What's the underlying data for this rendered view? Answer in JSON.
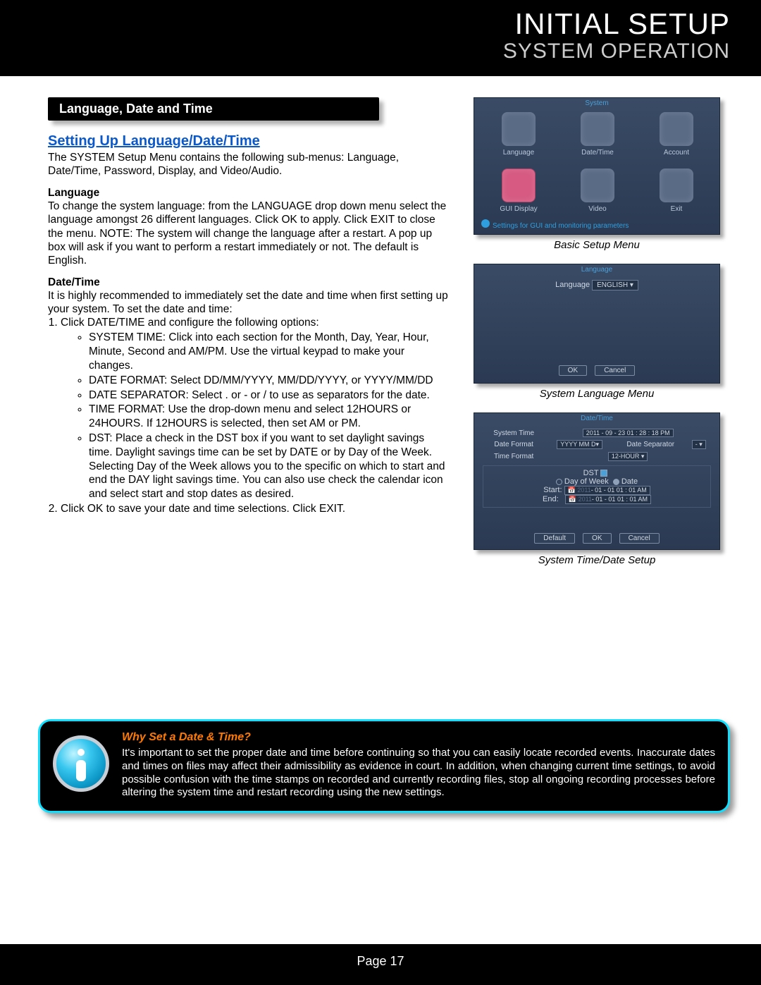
{
  "header": {
    "title1": "INITIAL SETUP",
    "title2": "SYSTEM OPERATION"
  },
  "sectionBar": "Language, Date and Time",
  "settingTitle": "Setting Up Language/Date/Time",
  "intro": "The SYSTEM Setup Menu contains the following sub-menus: Language, Date/Time, Password, Display, and Video/Audio.",
  "lang": {
    "head": "Language",
    "body": "To change the system language: from the LANGUAGE drop down menu select the language amongst 26 different languages. Click OK to apply. Click EXIT to close the menu. NOTE: The system will change the language after a restart. A pop up box will ask if you want to perform a restart immediately or not. The default is English."
  },
  "dt": {
    "head": "Date/Time",
    "lead": "It is highly recommended to immediately set the date and time when first setting up your system. To set the date and time:",
    "step1": "Click DATE/TIME and configure the following options:",
    "bullets": [
      "SYSTEM TIME: Click into each section for the Month, Day, Year, Hour, Minute, Second and AM/PM. Use the virtual keypad to make your changes.",
      "DATE FORMAT: Select DD/MM/YYYY, MM/DD/YYYY, or YYYY/MM/DD",
      "DATE SEPARATOR: Select . or  -   or / to use as separators for the date.",
      "TIME FORMAT: Use the drop-down menu and select 12HOURS or 24HOURS. If 12HOURS is selected, then set AM or PM.",
      "DST: Place a check in the DST box if you want to set daylight savings time. Daylight savings time can be set by DATE or by Day of the Week. Selecting Day of the Week allows you to the specific on which to start and end the DAY light savings time. You can also use check the calendar icon and select start and stop dates as desired."
    ],
    "step2": "Click OK to save your date and time selections. Click EXIT."
  },
  "captions": {
    "c1": "Basic Setup Menu",
    "c2": "System Language Menu",
    "c3": "System Time/Date Setup"
  },
  "mock1": {
    "title": "System",
    "items": [
      "Language",
      "Date/Time",
      "Account",
      "GUI Display",
      "Video",
      "Exit"
    ],
    "hint": "Settings for GUI and monitoring parameters"
  },
  "mock2": {
    "title": "Language",
    "label": "Language",
    "value": "ENGLISH",
    "ok": "OK",
    "cancel": "Cancel"
  },
  "mock3": {
    "title": "Date/Time",
    "rows": {
      "systime_lbl": "System Time",
      "systime_val": "2011 - 09 - 23  01 : 28 : 18   PM",
      "datefmt_lbl": "Date Format",
      "datefmt_val": "YYYY MM D",
      "datesep_lbl": "Date Separator",
      "datesep_val": "-",
      "timefmt_lbl": "Time Format",
      "timefmt_val": "12-HOUR"
    },
    "dst": {
      "label": "DST",
      "dow": "Day of Week",
      "date": "Date",
      "start": "Start:",
      "end": "End:",
      "start_val": "- 01 - 01  01 : 01       AM",
      "end_val": "- 01 - 01  01 : 01       AM"
    },
    "default": "Default",
    "ok": "OK",
    "cancel": "Cancel"
  },
  "info": {
    "q": "Why Set a Date & Time?",
    "a": "It's important to set the proper date and time before continuing so that you can easily locate recorded events. Inaccurate dates and times on files may affect their admissibility as evidence in court. In addition, when changing current time settings, to avoid possible confusion with the time stamps on recorded and currently recording files, stop all ongoing recording processes before altering the system time and restart recording using the new settings."
  },
  "footer": {
    "page_label": "Page  17"
  }
}
